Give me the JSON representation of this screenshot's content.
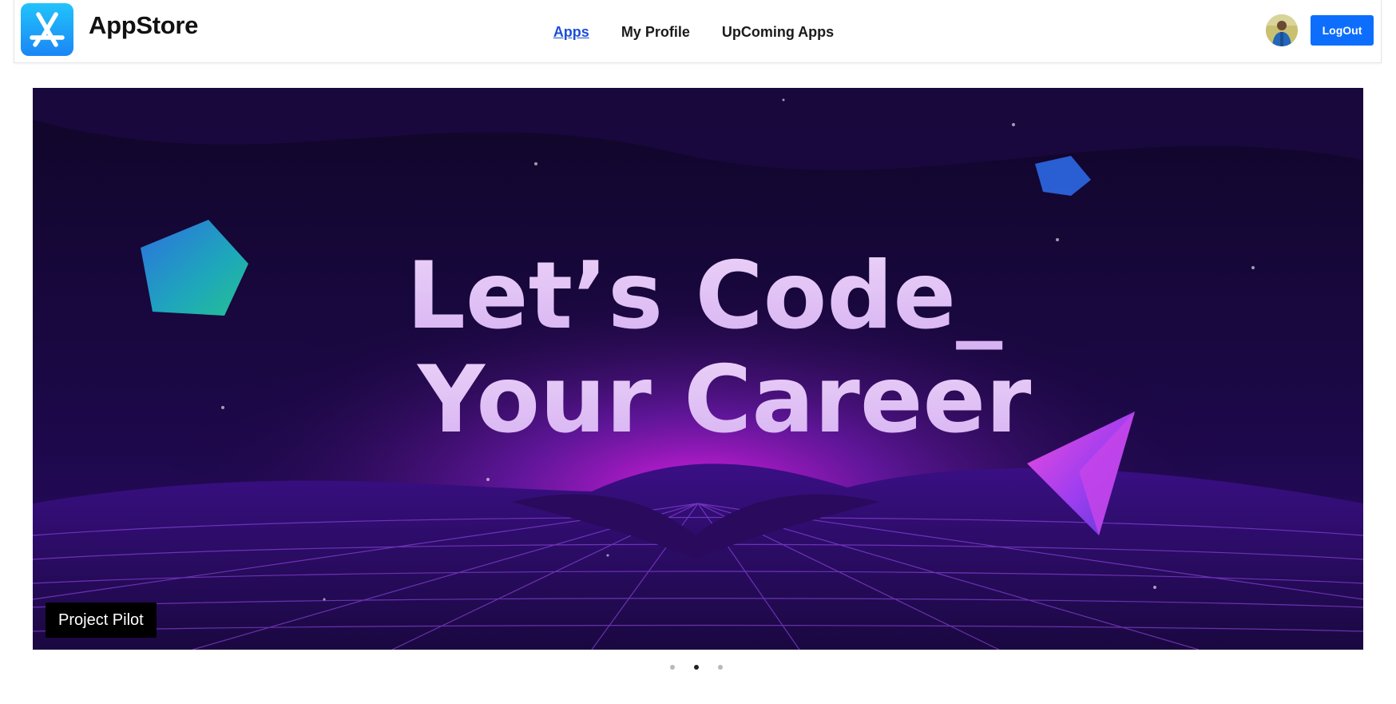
{
  "header": {
    "brand": "AppStore",
    "nav": [
      {
        "label": "Apps",
        "active": true
      },
      {
        "label": "My Profile",
        "active": false
      },
      {
        "label": "UpComing Apps",
        "active": false
      }
    ],
    "logout_label": "LogOut",
    "logo_icon": "app-store-icon",
    "avatar": "user-avatar",
    "accent_color": "#0d6efd",
    "link_active_color": "#1d4ed8"
  },
  "carousel": {
    "slide_text_line1": "Let’s Code_",
    "slide_text_line2": "Your Career",
    "caption": "Project Pilot",
    "slide_count": 3,
    "active_index": 1
  }
}
